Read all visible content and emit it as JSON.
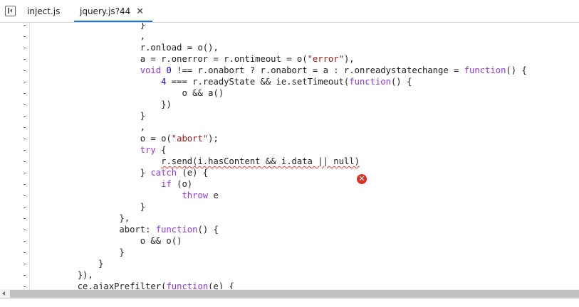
{
  "tabs": [
    {
      "label": "inject.js"
    },
    {
      "label": "jquery.js?44",
      "close": "✕"
    }
  ],
  "icons": {
    "nav_toggle": "sidebar-toggle-icon",
    "error": "error-icon"
  },
  "error_glyph": "✕",
  "gutter_marker": "-",
  "code_lines": [
    "                    }",
    "                    ,",
    "                    r.onload = o(),",
    "                    a = r.onerror = r.ontimeout = o(\"error\"),",
    "                    void 0 !== r.onabort ? r.onabort = a : r.onreadystatechange = function() {",
    "                        4 === r.readyState && ie.setTimeout(function() {",
    "                            o && a()",
    "                        })",
    "                    }",
    "                    ,",
    "                    o = o(\"abort\");",
    "                    try {",
    "                        r.send(i.hasContent && i.data || null)",
    "                    } catch (e) {",
    "                        if (o)",
    "                            throw e",
    "                    }",
    "                },",
    "                abort: function() {",
    "                    o && o()",
    "                }",
    "            }",
    "        }),",
    "        ce.ajaxPrefilter(function(e) {"
  ],
  "colors": {
    "keyword": "#9334e6",
    "string": "#a31515",
    "number": "#1c00cf",
    "error": "#d93025",
    "tab_active": "#1a73e8"
  }
}
